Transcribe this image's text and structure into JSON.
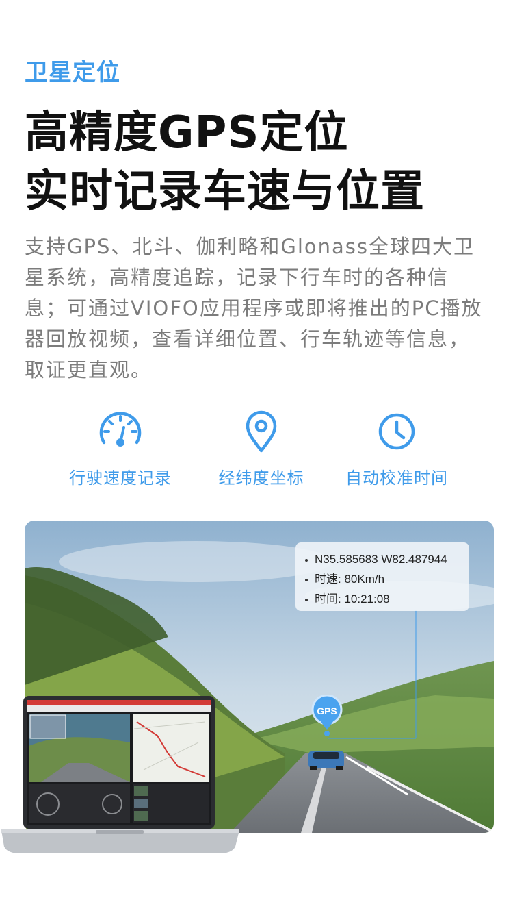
{
  "eyebrow": "卫星定位",
  "headline": {
    "line1": "高精度GPS定位",
    "line2": "实时记录车速与位置"
  },
  "description": "支持GPS、北斗、伽利略和Glonass全球四大卫星系统，高精度追踪，记录下行车时的各种信息；可通过VIOFO应用程序或即将推出的PC播放器回放视频，查看详细位置、行车轨迹等信息，取证更直观。",
  "features": [
    {
      "label": "行驶速度记录",
      "icon": "speedometer-icon"
    },
    {
      "label": "经纬度坐标",
      "icon": "location-pin-icon"
    },
    {
      "label": "自动校准时间",
      "icon": "clock-icon"
    }
  ],
  "gps_info": {
    "coords": "N35.585683 W82.487944",
    "speed": "时速: 80Km/h",
    "time": "时间: 10:21:08"
  },
  "gps_marker_label": "GPS",
  "colors": {
    "accent": "#3f9bea",
    "headline": "#111111",
    "body_text": "#7c7c7c"
  }
}
